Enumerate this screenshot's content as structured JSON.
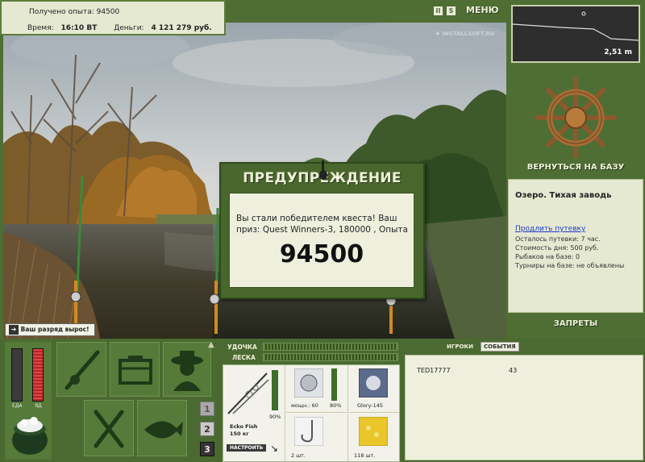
{
  "top_info": {
    "exp_label": "Получено опыта: 94500",
    "time_label": "Время:",
    "time_value": "16:10 ВТ",
    "money_label": "Деньги:",
    "money_value": "4 121 279 руб."
  },
  "topbar": {
    "pause": "II",
    "sound": "S",
    "menu": "МЕНЮ",
    "watermark": "INSTALLSOFT.RU"
  },
  "depth": {
    "value": "2,51 m"
  },
  "right_panel": {
    "return_label": "ВЕРНУТЬСЯ НА БАЗУ",
    "location": "Озеро. Тихая заводь",
    "extend_link": "Продлить путевку",
    "lines": [
      "Осталось путевки: 7 час.",
      "Стоимость дня: 500 руб.",
      "Рыбаков на базе: 0",
      "Турниры на базе: не объявлены"
    ],
    "bans": "ЗАПРЕТЫ"
  },
  "notice": {
    "text": "Ваш разряд вырос!"
  },
  "dialog": {
    "title": "ПРЕДУПРЕЖДЕНИЕ",
    "text": "Вы стали победителем квеста! Ваш приз: Quest Winners-3, 180000 , Опыта",
    "value": "94500"
  },
  "status_bars": {
    "food_label": "ЕДА",
    "poison_label": "ЯД"
  },
  "page_buttons": [
    "1",
    "2",
    "3"
  ],
  "tackle": {
    "rod_label": "УДОЧКА",
    "line_label": "ЛЕСКА",
    "rod_name": "Ecko Fish",
    "rod_weight": "150 кг",
    "rod_percent": "90%",
    "setup_button": "НАСТРОИТЬ",
    "reel_power": "мощн.: 60",
    "reel_percent": "80%",
    "line_name": "Glory-145",
    "hook_count": "2 шт.",
    "bait_count": "118 шт."
  },
  "players": {
    "tab_players": "ИГРОКИ",
    "tab_events": "СОБЫТИЯ",
    "rows": [
      {
        "name": "TED17777",
        "value": "43"
      }
    ]
  }
}
